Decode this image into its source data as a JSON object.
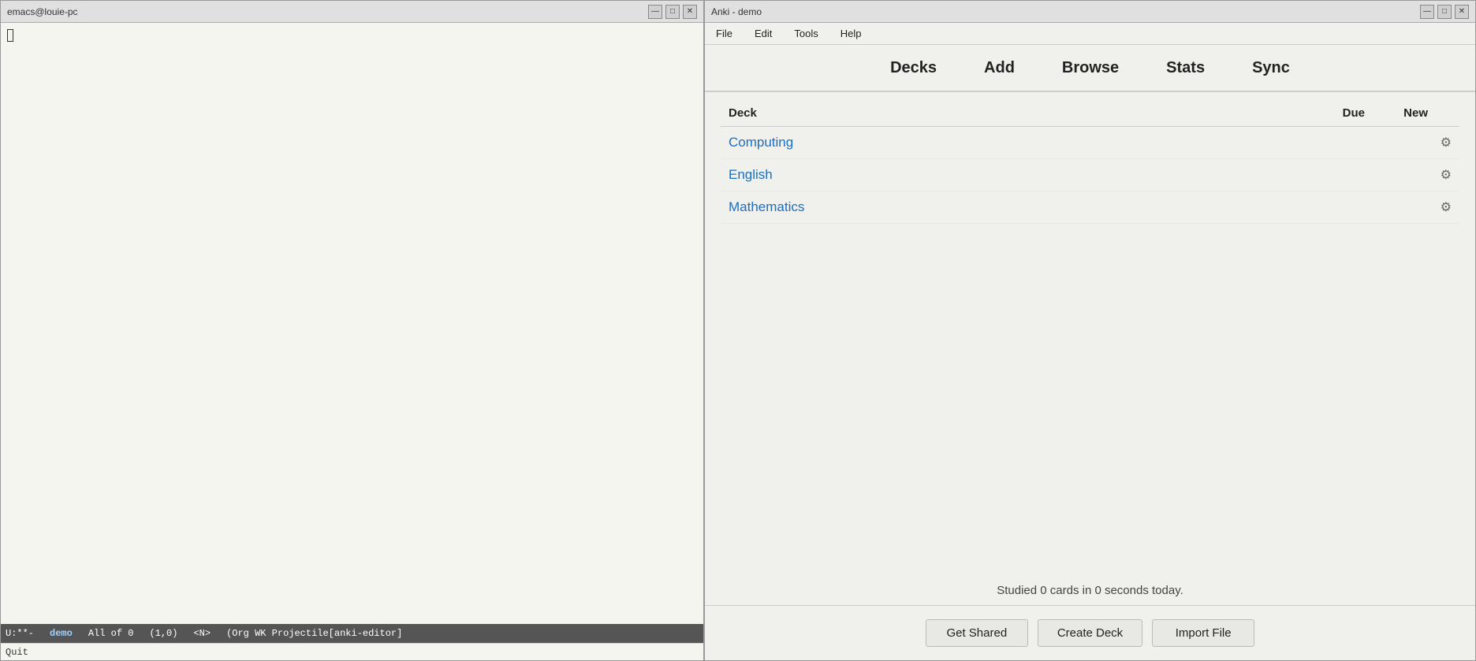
{
  "emacs": {
    "title": "emacs@louie-pc",
    "buttons": {
      "minimize": "—",
      "maximize": "□",
      "close": "✕"
    },
    "statusbar": {
      "mode": "U:**-",
      "buffer": "demo",
      "position": "All of 0",
      "cursor": "(1,0)",
      "extra": "<N>",
      "mode_info": "(Org WK Projectile[anki-editor]"
    },
    "bottombar": "Quit",
    "of_label": "of"
  },
  "anki": {
    "title": "Anki - demo",
    "buttons": {
      "minimize": "—",
      "maximize": "□",
      "close": "✕"
    },
    "menu": {
      "file": "File",
      "edit": "Edit",
      "tools": "Tools",
      "help": "Help"
    },
    "toolbar": {
      "decks": "Decks",
      "add": "Add",
      "browse": "Browse",
      "stats": "Stats",
      "sync": "Sync"
    },
    "table": {
      "col_deck": "Deck",
      "col_due": "Due",
      "col_new": "New"
    },
    "decks": [
      {
        "name": "Computing",
        "due": "",
        "new": ""
      },
      {
        "name": "English",
        "due": "",
        "new": ""
      },
      {
        "name": "Mathematics",
        "due": "",
        "new": ""
      }
    ],
    "studied_text": "Studied 0 cards in 0 seconds today.",
    "footer": {
      "get_shared": "Get Shared",
      "create_deck": "Create Deck",
      "import_file": "Import File"
    }
  }
}
